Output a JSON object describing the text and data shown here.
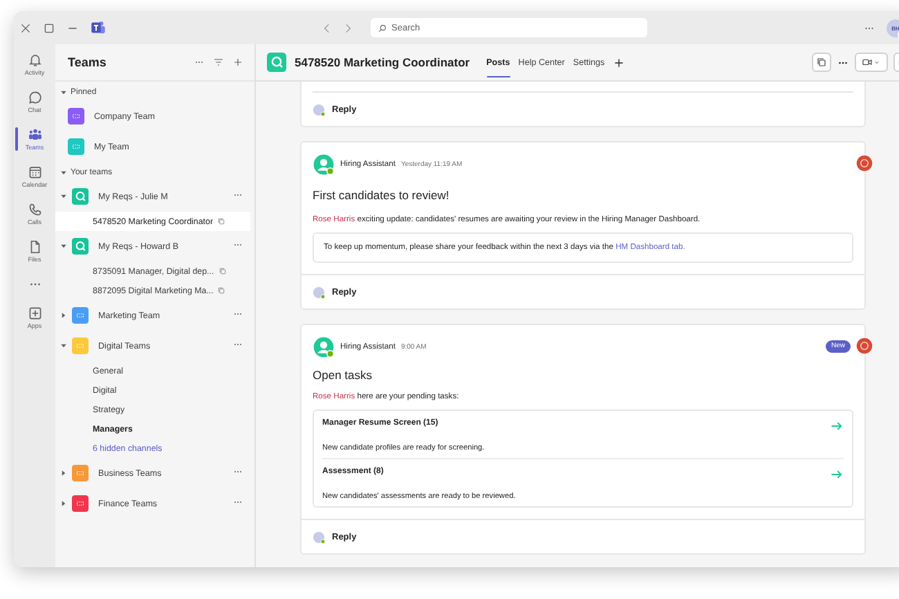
{
  "search": {
    "placeholder": "Search"
  },
  "account": {
    "initials": "BH"
  },
  "rail": [
    {
      "label": "Activity",
      "selected": false
    },
    {
      "label": "Chat",
      "selected": false
    },
    {
      "label": "Teams",
      "selected": true
    },
    {
      "label": "Calendar",
      "selected": false
    },
    {
      "label": "Calls",
      "selected": false
    },
    {
      "label": "Files",
      "selected": false
    },
    {
      "selected": false
    },
    {
      "label": "Apps",
      "selected": false
    }
  ],
  "sidebar": {
    "title": "Teams",
    "sections": [
      {
        "label": "Pinned",
        "expanded": true,
        "teams": [
          {
            "name": "Company Team",
            "color": "#8b5cf6"
          },
          {
            "name": "My Team",
            "color": "#1fc8c0"
          }
        ]
      },
      {
        "label": "Your teams",
        "expanded": true,
        "teams": [
          {
            "name": "My Reqs - Julie M",
            "color": "#19c39a",
            "kind": "req",
            "expanded": true,
            "children": [
              {
                "name": "5478520 Marketing Coordinator",
                "kind": "req",
                "selected": true,
                "bold": false
              }
            ]
          },
          {
            "name": "My Reqs - Howard B",
            "color": "#19c39a",
            "kind": "req",
            "expanded": true,
            "children": [
              {
                "name": "8735091 Manager, Digital dep...",
                "kind": "req",
                "selected": false,
                "bold": false
              },
              {
                "name": "8872095 Digital Marketing Ma...",
                "kind": "req",
                "selected": false,
                "bold": false
              }
            ]
          },
          {
            "name": "Marketing Team",
            "color": "#4a9ff5",
            "expanded": false
          },
          {
            "name": "Digital Teams",
            "color": "#fcc83c",
            "expanded": true,
            "children": [
              {
                "name": "General",
                "kind": "channel",
                "selected": false,
                "bold": false
              },
              {
                "name": "Digital",
                "kind": "channel",
                "selected": false,
                "bold": false
              },
              {
                "name": "Strategy",
                "kind": "channel",
                "selected": false,
                "bold": false
              },
              {
                "name": "Managers",
                "kind": "channel",
                "selected": false,
                "bold": true
              },
              {
                "name": "6 hidden channels",
                "kind": "link",
                "selected": false,
                "bold": false
              }
            ]
          },
          {
            "name": "Business Teams",
            "color": "#f7993a",
            "expanded": false
          },
          {
            "name": "Finance Teams",
            "color": "#f0364f",
            "expanded": false
          }
        ]
      }
    ]
  },
  "channel": {
    "title": "5478520 Marketing Coordinator",
    "tabs": [
      {
        "label": "Posts",
        "selected": true
      },
      {
        "label": "Help Center",
        "selected": false
      },
      {
        "label": "Settings",
        "selected": false
      }
    ]
  },
  "posts": [
    {
      "kind": "tail",
      "reply": "Reply"
    },
    {
      "kind": "message",
      "author": "Hiring Assistant",
      "time": "Yesterday 11:19 AM",
      "new": false,
      "title": "First candidates to review!",
      "mention": "Rose Harris",
      "text": "exciting update: candidates' resumes are awaiting your review in the Hiring Manager Dashboard.",
      "note": "To keep up momentum, please share your feedback within the next 3 days via the",
      "link": "HM Dashboard tab.",
      "reply": "Reply"
    },
    {
      "kind": "message",
      "author": "Hiring Assistant",
      "time": "9:00 AM",
      "new": true,
      "badge": "New",
      "title": "Open tasks",
      "mention": "Rose Harris",
      "text": "here are your pending tasks:",
      "tasks": [
        {
          "title": "Manager Resume Screen (15)",
          "text": "New candidate profiles are ready for screening."
        },
        {
          "title": "Assessment (8)",
          "text": "New candidates' assessments are ready to be reviewed."
        }
      ],
      "reply": "Reply"
    }
  ]
}
